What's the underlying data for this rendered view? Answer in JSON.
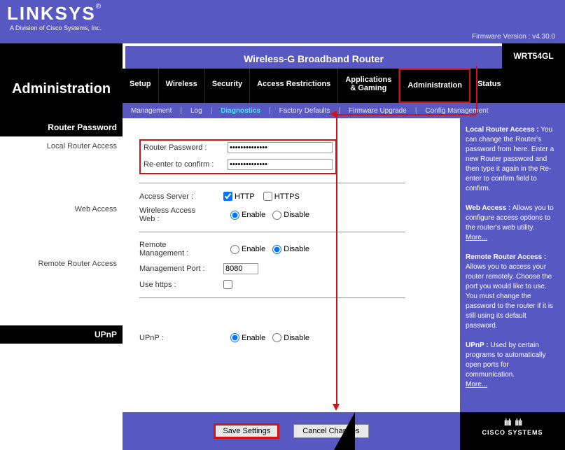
{
  "header": {
    "brand": "LINKSYS",
    "brand_reg": "®",
    "brand_sub": "A Division of Cisco Systems, Inc.",
    "firmware_label": "Firmware Version :",
    "firmware_version": "v4.30.0",
    "device_title": "Wireless-G Broadband Router",
    "model": "WRT54GL",
    "page_title": "Administration"
  },
  "main_tabs": {
    "setup": "Setup",
    "wireless": "Wireless",
    "security": "Security",
    "access": "Access Restrictions",
    "apps_line1": "Applications",
    "apps_line2": "& Gaming",
    "admin": "Administration",
    "status": "Status"
  },
  "sub_tabs": {
    "management": "Management",
    "log": "Log",
    "diagnostics": "Diagnostics",
    "factory": "Factory Defaults",
    "firmware": "Firmware Upgrade",
    "config": "Config Management"
  },
  "sections": {
    "router_password": "Router Password",
    "local_access": "Local Router Access",
    "web_access": "Web Access",
    "remote_access": "Remote Router Access",
    "upnp": "UPnP"
  },
  "form": {
    "router_password_label": "Router Password :",
    "router_password_value": "••••••••••••••",
    "reenter_label": "Re-enter to  confirm :",
    "reenter_value": "••••••••••••••",
    "access_server_label": "Access Server :",
    "http": "HTTP",
    "https": "HTTPS",
    "wireless_access_label1": "Wireless Access",
    "wireless_access_label2": "Web  :",
    "enable": "Enable",
    "disable": "Disable",
    "remote_mgmt_label1": "Remote",
    "remote_mgmt_label2": "Management :",
    "mgmt_port_label": "Management Port :",
    "mgmt_port_value": "8080",
    "use_https_label": "Use https  :",
    "upnp_label": "UPnP :"
  },
  "help": {
    "local_title": "Local Router Access :",
    "local_text": " You can change the Router's password from here. Enter a new Router password and then type it again in the Re-enter to confirm field to confirm.",
    "web_title": "Web Access :",
    "web_text": " Allows you to configure access options to the router's web utility.",
    "remote_title": "Remote Router Access :",
    "remote_text": "Allows you to access your router remotely. Choose the port you would like to use. You must change the password to the router if it is still using its default password.",
    "upnp_title": "UPnP :",
    "upnp_text": " Used by certain programs to automatically open ports for communication.",
    "more": "More..."
  },
  "buttons": {
    "save": "Save Settings",
    "cancel": "Cancel Changes"
  },
  "footer": {
    "cisco": "CISCO SYSTEMS"
  }
}
